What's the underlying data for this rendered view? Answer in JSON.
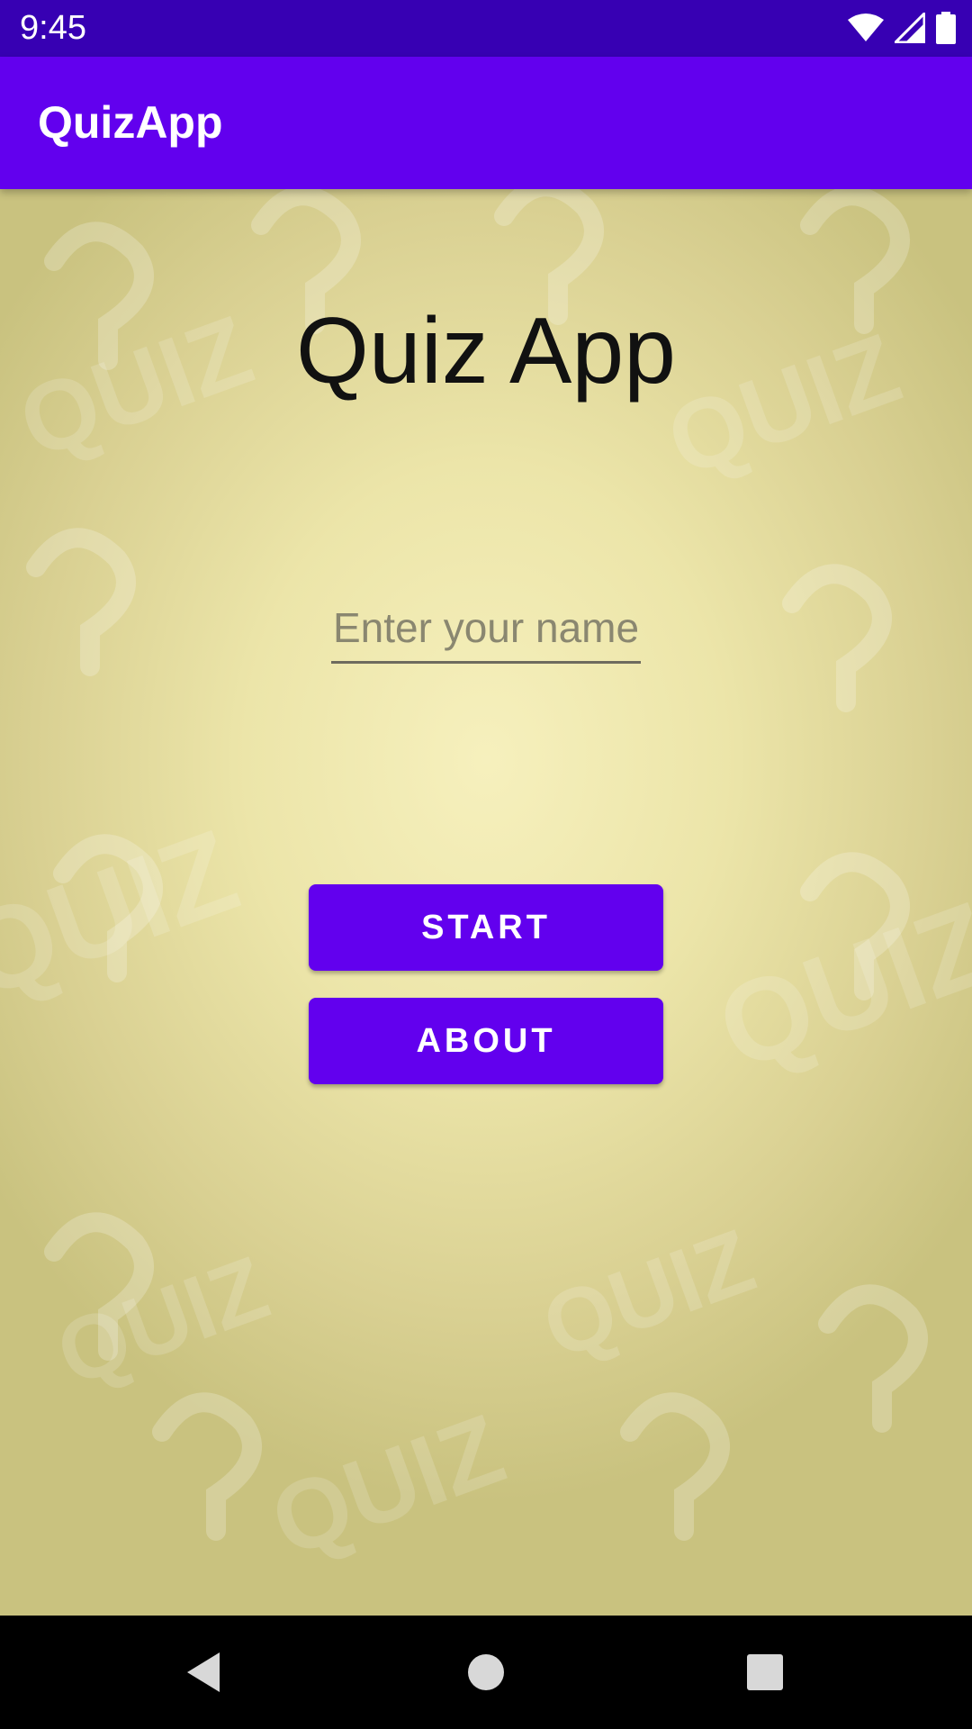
{
  "status_bar": {
    "time": "9:45",
    "icons": [
      "wifi-icon",
      "cell-signal-icon",
      "battery-icon"
    ],
    "background": "#3700B3"
  },
  "app_bar": {
    "title": "QuizApp",
    "background": "#6200EE"
  },
  "main": {
    "title": "Quiz App",
    "name_input": {
      "placeholder": "Enter your name",
      "value": ""
    },
    "buttons": {
      "start_label": "START",
      "about_label": "ABOUT"
    },
    "button_color": "#6200EE"
  },
  "nav_bar": {
    "icons": [
      "back-icon",
      "home-icon",
      "recents-icon"
    ]
  }
}
